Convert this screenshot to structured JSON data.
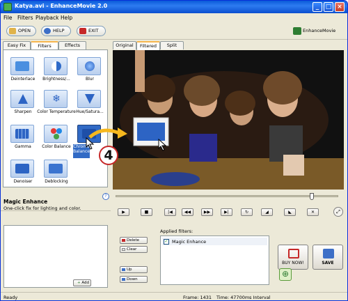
{
  "window": {
    "title": "Katya.avi - EnhanceMovie 2.0"
  },
  "menu": [
    "File",
    "Filters",
    "Playback",
    "Help"
  ],
  "toolbar": {
    "open": "OPEN",
    "help": "HELP",
    "exit": "EXIT",
    "brand": "EnhanceMovie"
  },
  "left_tabs": [
    "Easy Fix",
    "Filters",
    "Effects"
  ],
  "filters": [
    {
      "label": "Deinterlace",
      "icon": "deinterlace-icon"
    },
    {
      "label": "Brightness/...",
      "icon": "brightness-icon"
    },
    {
      "label": "Blur",
      "icon": "blur-icon"
    },
    {
      "label": "Sharpen",
      "icon": "sharpen-icon"
    },
    {
      "label": "Color Temperature",
      "icon": "color-temperature-icon"
    },
    {
      "label": "Hue/Satura...",
      "icon": "hue-saturation-icon"
    },
    {
      "label": "Gamma",
      "icon": "gamma-icon"
    },
    {
      "label": "Color Balance",
      "icon": "color-balance-icon"
    },
    {
      "label": "Chroma Balance",
      "icon": "chroma-balance-icon",
      "selected": true
    },
    {
      "label": "Denoiser",
      "icon": "denoiser-icon"
    },
    {
      "label": "Deblocking",
      "icon": "deblocking-icon"
    }
  ],
  "view_tabs": [
    "Original",
    "Filtered",
    "Split"
  ],
  "step_badge": "4",
  "help_mark": "?",
  "info": {
    "title": "Magic Enhance",
    "description": "One-click fix for lighting and color."
  },
  "add_button": "Add",
  "side_buttons": {
    "delete": "Delete",
    "clear": "Clear",
    "up": "Up",
    "down": "Down"
  },
  "applied": {
    "label": "Applied filters:",
    "items": [
      {
        "name": "Magic Enhance",
        "checked": true
      }
    ]
  },
  "buy_button": "BUY NOW!",
  "save_button": "SAVE",
  "status": {
    "left": "Ready",
    "frame": "Frame: 1431",
    "time": "Time: 47700ms Interval"
  }
}
